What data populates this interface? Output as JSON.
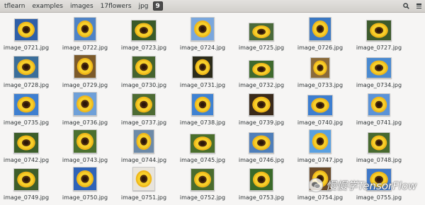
{
  "toolbar": {
    "breadcrumbs": [
      "tflearn",
      "examples",
      "images",
      "17flowers",
      "jpg",
      "9"
    ],
    "active_crumb": "9",
    "search_icon": "search-icon",
    "menu_icon": "menu-icon"
  },
  "files": [
    {
      "name": "image_0721.jpg",
      "sky": "#2f5fa8"
    },
    {
      "name": "image_0722.jpg",
      "sky": "#4f83c6"
    },
    {
      "name": "image_0723.jpg",
      "sky": "#3a5a2a"
    },
    {
      "name": "image_0724.jpg",
      "sky": "#7aa7dd"
    },
    {
      "name": "image_0725.jpg",
      "sky": "#4a6a3a"
    },
    {
      "name": "image_0726.jpg",
      "sky": "#3b78c2"
    },
    {
      "name": "image_0727.jpg",
      "sky": "#3d5a2c"
    },
    {
      "name": "image_0728.jpg",
      "sky": "#3b6e9a"
    },
    {
      "name": "image_0729.jpg",
      "sky": "#7c5a2a"
    },
    {
      "name": "image_0730.jpg",
      "sky": "#45632f"
    },
    {
      "name": "image_0731.jpg",
      "sky": "#2b2b1a"
    },
    {
      "name": "image_0732.jpg",
      "sky": "#3f6a2e"
    },
    {
      "name": "image_0733.jpg",
      "sky": "#8a6a3a"
    },
    {
      "name": "image_0734.jpg",
      "sky": "#4a8ad0"
    },
    {
      "name": "image_0735.jpg",
      "sky": "#3e7fd0"
    },
    {
      "name": "image_0736.jpg",
      "sky": "#6fa0d8"
    },
    {
      "name": "image_0737.jpg",
      "sky": "#4d6b33"
    },
    {
      "name": "image_0738.jpg",
      "sky": "#3f82d2"
    },
    {
      "name": "image_0739.jpg",
      "sky": "#3a2a1a"
    },
    {
      "name": "image_0740.jpg",
      "sky": "#3d7ed0"
    },
    {
      "name": "image_0741.jpg",
      "sky": "#5b93d8"
    },
    {
      "name": "image_0742.jpg",
      "sky": "#3c5e2a"
    },
    {
      "name": "image_0743.jpg",
      "sky": "#4b7030"
    },
    {
      "name": "image_0744.jpg",
      "sky": "#6d8aa8"
    },
    {
      "name": "image_0745.jpg",
      "sky": "#4a6e2c"
    },
    {
      "name": "image_0746.jpg",
      "sky": "#4f7fba"
    },
    {
      "name": "image_0747.jpg",
      "sky": "#5aa0e0"
    },
    {
      "name": "image_0748.jpg",
      "sky": "#47692f"
    },
    {
      "name": "image_0749.jpg",
      "sky": "#3e5d2a"
    },
    {
      "name": "image_0750.jpg",
      "sky": "#2f63b8"
    },
    {
      "name": "image_0751.jpg",
      "sky": "#e8e4dc"
    },
    {
      "name": "image_0752.jpg",
      "sky": "#4a6c2e"
    },
    {
      "name": "image_0753.jpg",
      "sky": "#3a6a2a"
    },
    {
      "name": "image_0754.jpg",
      "sky": "#6a4a2a"
    },
    {
      "name": "image_0755.jpg",
      "sky": "#3f78c8"
    }
  ],
  "watermark": {
    "text": "慢慢学TensorFlow"
  }
}
